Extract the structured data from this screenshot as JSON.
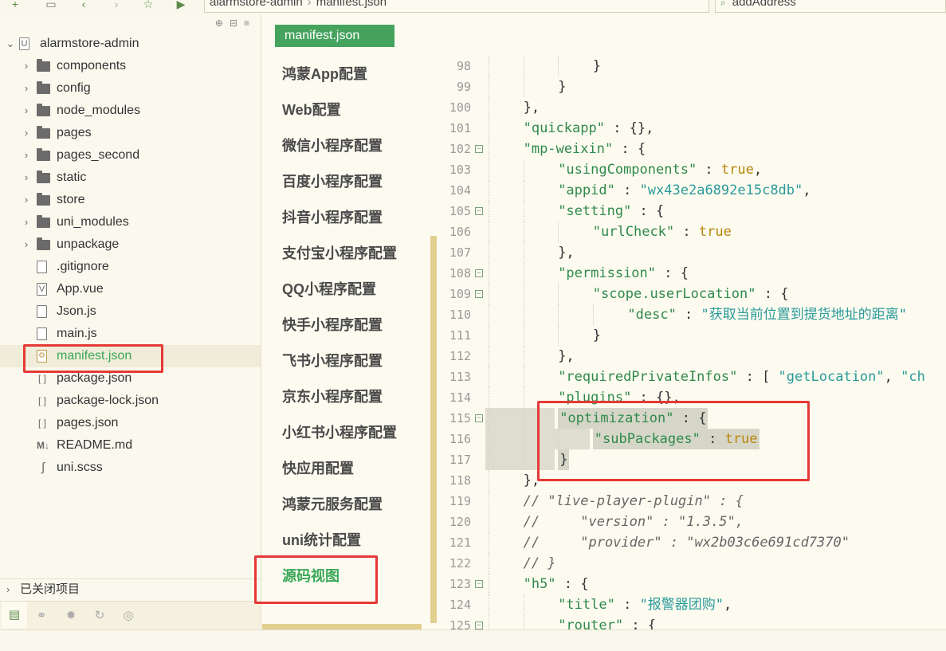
{
  "toolbar": {
    "breadcrumb": [
      "alarmstore-admin",
      "manifest.json"
    ],
    "search_value": "addAddress"
  },
  "sidebar": {
    "project_name": "alarmstore-admin",
    "items": [
      {
        "label": "components",
        "type": "folder"
      },
      {
        "label": "config",
        "type": "folder"
      },
      {
        "label": "node_modules",
        "type": "folder"
      },
      {
        "label": "pages",
        "type": "folder"
      },
      {
        "label": "pages_second",
        "type": "folder"
      },
      {
        "label": "static",
        "type": "folder"
      },
      {
        "label": "store",
        "type": "folder"
      },
      {
        "label": "uni_modules",
        "type": "folder"
      },
      {
        "label": "unpackage",
        "type": "folder"
      },
      {
        "label": ".gitignore",
        "type": "file"
      },
      {
        "label": "App.vue",
        "type": "vue"
      },
      {
        "label": "Json.js",
        "type": "js"
      },
      {
        "label": "main.js",
        "type": "js"
      },
      {
        "label": "manifest.json",
        "type": "manifest"
      },
      {
        "label": "package.json",
        "type": "json"
      },
      {
        "label": "package-lock.json",
        "type": "json"
      },
      {
        "label": "pages.json",
        "type": "json"
      },
      {
        "label": "README.md",
        "type": "md"
      },
      {
        "label": "uni.scss",
        "type": "scss"
      }
    ],
    "closed_projects": "已关闭项目"
  },
  "menu": {
    "tab": "manifest.json",
    "items": [
      "鸿蒙App配置",
      "Web配置",
      "微信小程序配置",
      "百度小程序配置",
      "抖音小程序配置",
      "支付宝小程序配置",
      "QQ小程序配置",
      "快手小程序配置",
      "飞书小程序配置",
      "京东小程序配置",
      "小红书小程序配置",
      "快应用配置",
      "鸿蒙元服务配置",
      "uni统计配置",
      "源码视图"
    ],
    "active_index": 14
  },
  "editor": {
    "lines": [
      {
        "n": "98",
        "indent": 3,
        "tokens": [
          [
            "p",
            "}"
          ]
        ]
      },
      {
        "n": "99",
        "indent": 2,
        "tokens": [
          [
            "p",
            "}"
          ]
        ]
      },
      {
        "n": "100",
        "indent": 1,
        "tokens": [
          [
            "p",
            "},"
          ]
        ]
      },
      {
        "n": "101",
        "indent": 1,
        "tokens": [
          [
            "k",
            "\"quickapp\""
          ],
          [
            "p",
            " : {},"
          ]
        ]
      },
      {
        "n": "102",
        "indent": 1,
        "fold": true,
        "tokens": [
          [
            "k",
            "\"mp-weixin\""
          ],
          [
            "p",
            " : {"
          ]
        ]
      },
      {
        "n": "103",
        "indent": 2,
        "tokens": [
          [
            "k",
            "\"usingComponents\""
          ],
          [
            "p",
            " : "
          ],
          [
            "b",
            "true"
          ],
          [
            "p",
            ","
          ]
        ]
      },
      {
        "n": "104",
        "indent": 2,
        "tokens": [
          [
            "k",
            "\"appid\""
          ],
          [
            "p",
            " : "
          ],
          [
            "s",
            "\"wx43e2a6892e15c8db\""
          ],
          [
            "p",
            ","
          ]
        ]
      },
      {
        "n": "105",
        "indent": 2,
        "fold": true,
        "tokens": [
          [
            "k",
            "\"setting\""
          ],
          [
            "p",
            " : {"
          ]
        ]
      },
      {
        "n": "106",
        "indent": 3,
        "tokens": [
          [
            "k",
            "\"urlCheck\""
          ],
          [
            "p",
            " : "
          ],
          [
            "b",
            "true"
          ]
        ]
      },
      {
        "n": "107",
        "indent": 2,
        "tokens": [
          [
            "p",
            "},"
          ]
        ]
      },
      {
        "n": "108",
        "indent": 2,
        "fold": true,
        "tokens": [
          [
            "k",
            "\"permission\""
          ],
          [
            "p",
            " : {"
          ]
        ]
      },
      {
        "n": "109",
        "indent": 3,
        "fold": true,
        "tokens": [
          [
            "k",
            "\"scope.userLocation\""
          ],
          [
            "p",
            " : {"
          ]
        ]
      },
      {
        "n": "110",
        "indent": 4,
        "tokens": [
          [
            "k",
            "\"desc\""
          ],
          [
            "p",
            " : "
          ],
          [
            "s",
            "\"获取当前位置到提货地址的距离\""
          ]
        ]
      },
      {
        "n": "111",
        "indent": 3,
        "tokens": [
          [
            "p",
            "}"
          ]
        ]
      },
      {
        "n": "112",
        "indent": 2,
        "tokens": [
          [
            "p",
            "},"
          ]
        ]
      },
      {
        "n": "113",
        "indent": 2,
        "tokens": [
          [
            "k",
            "\"requiredPrivateInfos\""
          ],
          [
            "p",
            " : [ "
          ],
          [
            "s",
            "\"getLocation\""
          ],
          [
            "p",
            ", "
          ],
          [
            "s",
            "\"ch"
          ]
        ]
      },
      {
        "n": "114",
        "indent": 2,
        "tokens": [
          [
            "k",
            "\"plugins\""
          ],
          [
            "p",
            " : {},"
          ]
        ]
      },
      {
        "n": "115",
        "indent": 2,
        "fold": true,
        "hl": true,
        "tokens": [
          [
            "k",
            "\"optimization\""
          ],
          [
            "p",
            " : {"
          ]
        ]
      },
      {
        "n": "116",
        "indent": 3,
        "hl": true,
        "tokens": [
          [
            "k",
            "\"subPackages\""
          ],
          [
            "p",
            " : "
          ],
          [
            "b",
            "true"
          ]
        ]
      },
      {
        "n": "117",
        "indent": 2,
        "hl": true,
        "tokens": [
          [
            "p",
            "}"
          ]
        ]
      },
      {
        "n": "118",
        "indent": 1,
        "tokens": [
          [
            "p",
            "},"
          ]
        ]
      },
      {
        "n": "119",
        "indent": 1,
        "tokens": [
          [
            "c",
            "// \"live-player-plugin\" : {"
          ]
        ]
      },
      {
        "n": "120",
        "indent": 1,
        "tokens": [
          [
            "c",
            "//     \"version\" : \"1.3.5\","
          ]
        ]
      },
      {
        "n": "121",
        "indent": 1,
        "tokens": [
          [
            "c",
            "//     \"provider\" : \"wx2b03c6e691cd7370\""
          ]
        ]
      },
      {
        "n": "122",
        "indent": 1,
        "tokens": [
          [
            "c",
            "// }"
          ]
        ]
      },
      {
        "n": "123",
        "indent": 1,
        "fold": true,
        "tokens": [
          [
            "k",
            "\"h5\""
          ],
          [
            "p",
            " : {"
          ]
        ]
      },
      {
        "n": "124",
        "indent": 2,
        "tokens": [
          [
            "k",
            "\"title\""
          ],
          [
            "p",
            " : "
          ],
          [
            "s",
            "\"报警器团购\""
          ],
          [
            "p",
            ","
          ]
        ]
      },
      {
        "n": "125",
        "indent": 2,
        "fold": true,
        "tokens": [
          [
            "k",
            "\"router\""
          ],
          [
            "p",
            " : {"
          ]
        ]
      }
    ]
  },
  "colors": {
    "accent_green": "#46a35e",
    "annotation_red": "#e53935",
    "background": "#fdfbf0"
  }
}
